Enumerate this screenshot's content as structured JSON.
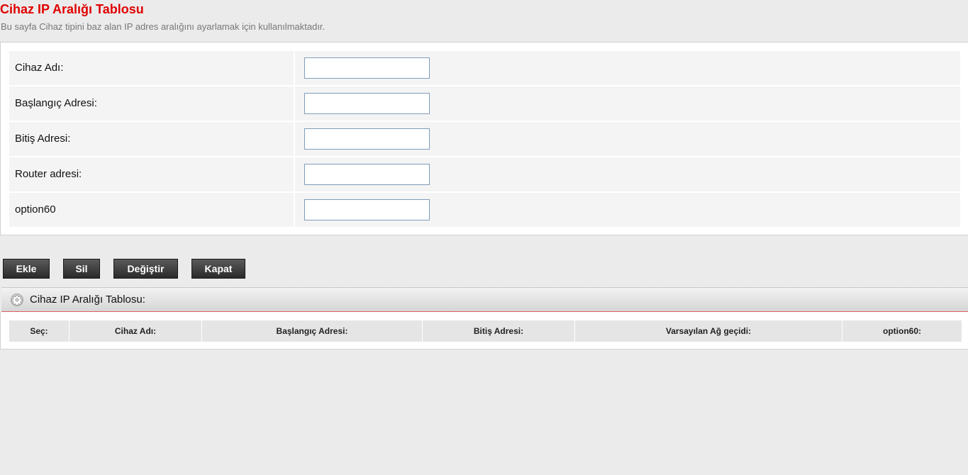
{
  "header": {
    "title": "Cihaz IP Aralığı Tablosu",
    "description": "Bu sayfa Cihaz tipini baz alan IP adres aralığını ayarlamak için kullanılmaktadır."
  },
  "form": {
    "fields": [
      {
        "label": "Cihaz Adı:",
        "value": ""
      },
      {
        "label": "Başlangıç Adresi:",
        "value": ""
      },
      {
        "label": "Bitiş Adresi:",
        "value": ""
      },
      {
        "label": "Router adresi:",
        "value": ""
      },
      {
        "label": "option60",
        "value": ""
      }
    ]
  },
  "buttons": {
    "add": "Ekle",
    "delete": "Sil",
    "modify": "Değiştir",
    "close": "Kapat"
  },
  "table_section": {
    "title": "Cihaz IP Aralığı Tablosu:",
    "icon": "gear-icon",
    "columns": [
      "Seç:",
      "Cihaz Adı:",
      "Başlangıç Adresi:",
      "Bitiş Adresi:",
      "Varsayılan Ağ geçidi:",
      "option60:"
    ],
    "rows": []
  },
  "colors": {
    "title": "#e00000",
    "button": "#333333",
    "header_border": "#e06060"
  }
}
